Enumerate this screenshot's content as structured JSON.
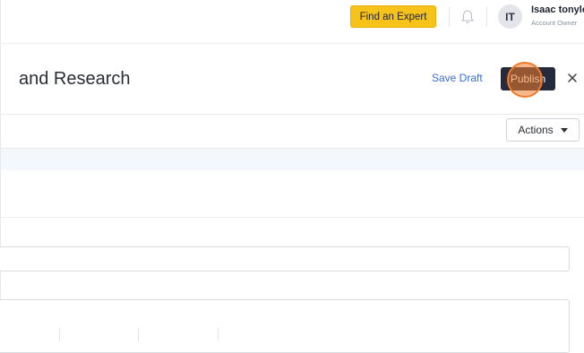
{
  "topbar": {
    "find_expert_label": "Find an Expert",
    "user": {
      "initials": "IT",
      "name": "Isaac tonylo",
      "role": "Account Owner"
    }
  },
  "header": {
    "title": "and Research",
    "save_draft_label": "Save Draft",
    "publish_label": "Publish",
    "close_icon": "close-icon"
  },
  "toolbar": {
    "actions_label": "Actions"
  },
  "icons": {
    "bell": "bell-icon",
    "caret": "caret-down-icon"
  },
  "colors": {
    "accent_yellow": "#f7c31b",
    "publish_bg": "#262a3b",
    "link_blue": "#3a6fd8",
    "click_marker": "#f07a2a"
  }
}
